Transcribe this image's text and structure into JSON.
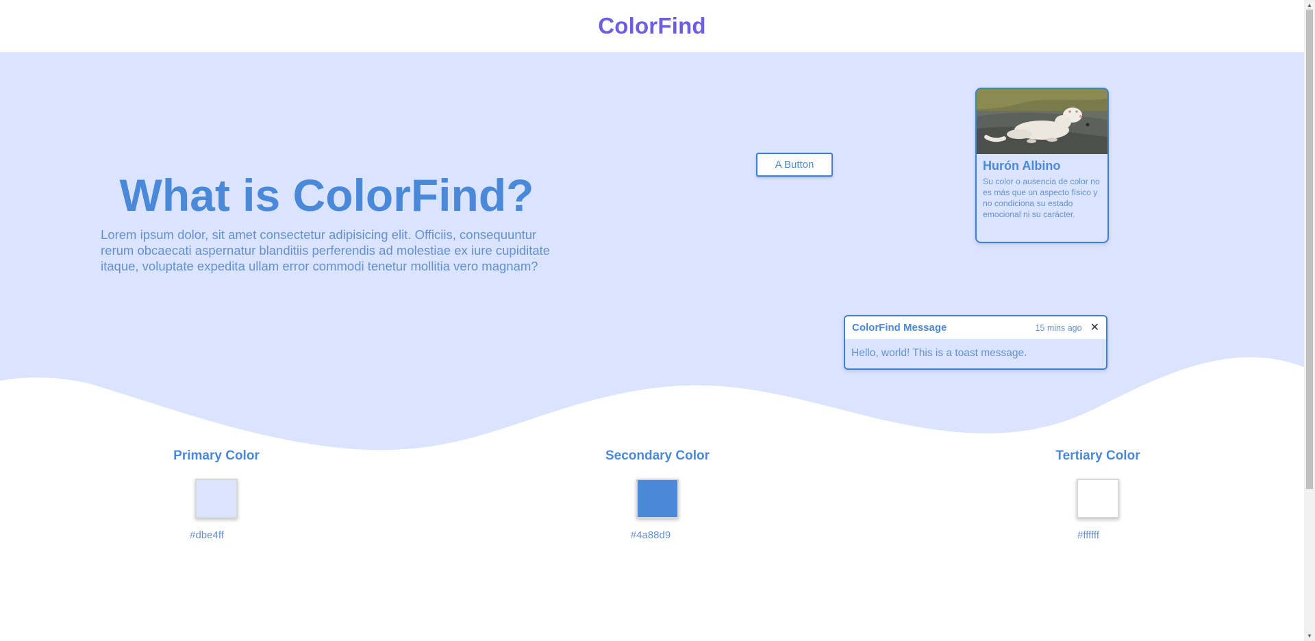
{
  "header": {
    "brand": "ColorFind"
  },
  "hero": {
    "title": "What is ColorFind?",
    "text": "Lorem ipsum dolor, sit amet consectetur adipisicing elit. Officiis, consequuntur rerum obcaecati aspernatur blanditiis perferendis ad molestiae ex iure cupiditate itaque, voluptate expedita ullam error commodi tenetur mollitia vero magnam?",
    "button_label": "A Button"
  },
  "card": {
    "title": "Hurón Albino",
    "text": "Su color o ausencia de color no es más que un aspecto físico y no condiciona su estado emocional ni su carácter."
  },
  "toast": {
    "title": "ColorFind Message",
    "time": "15 mins ago",
    "close": "✕",
    "body": "Hello, world! This is a toast message."
  },
  "colors": [
    {
      "label": "Primary Color",
      "hex": "#dbe4ff"
    },
    {
      "label": "Secondary Color",
      "hex": "#4a88d9"
    },
    {
      "label": "Tertiary Color",
      "hex": "#ffffff"
    }
  ]
}
